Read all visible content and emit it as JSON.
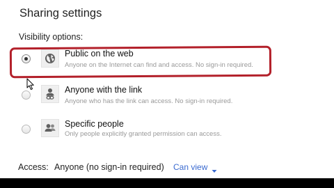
{
  "dialog": {
    "title": "Sharing settings",
    "visibility_label": "Visibility options:"
  },
  "options": [
    {
      "label": "Public on the web",
      "description": "Anyone on the Internet can find and access. No sign-in required.",
      "selected": true,
      "icon": "globe-icon"
    },
    {
      "label": "Anyone with the link",
      "description": "Anyone who has the link can access. No sign-in required.",
      "selected": false,
      "icon": "person-link-icon"
    },
    {
      "label": "Specific people",
      "description": "Only people explicitly granted permission can access.",
      "selected": false,
      "icon": "people-icon"
    }
  ],
  "access": {
    "label": "Access:",
    "value": "Anyone (no sign-in required)",
    "permission": "Can view"
  },
  "colors": {
    "highlight": "#b3202a",
    "link": "#3a6ad0"
  }
}
